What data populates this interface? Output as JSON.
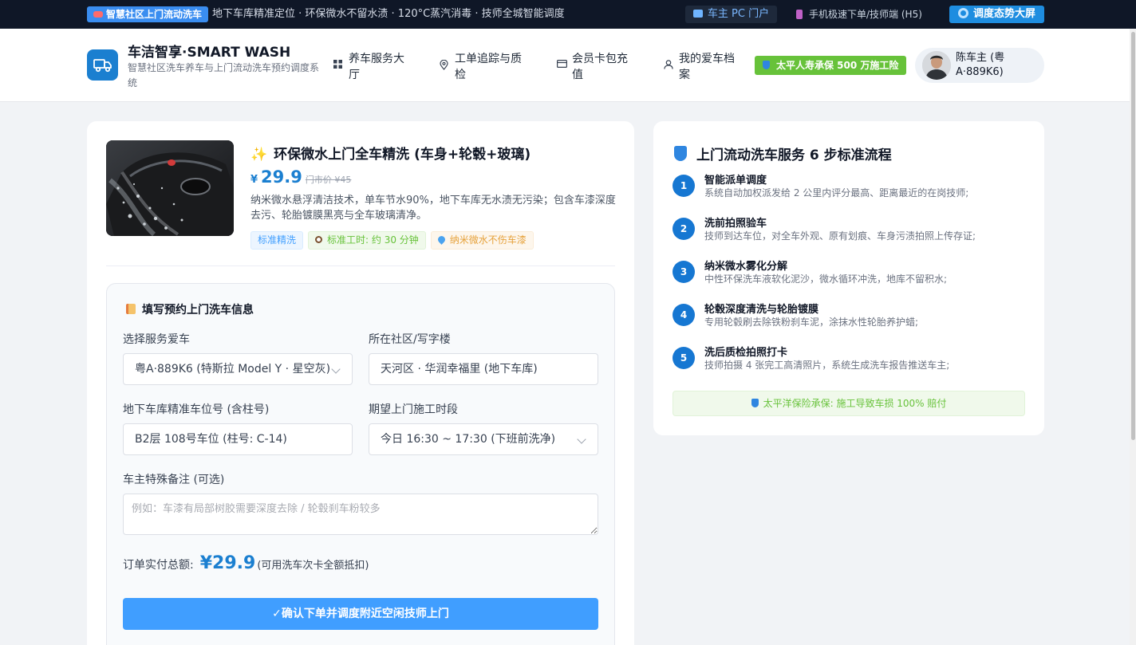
{
  "topbar": {
    "badge": "智慧社区上门流动洗车",
    "ticker": "地下车库精准定位 · 环保微水不留水渍 · 120°C蒸汽消毒 · 技师全城智能调度",
    "portal": "车主 PC 门户",
    "mobile": "手机极速下单/技师端 (H5)",
    "dashboard": "调度态势大屏"
  },
  "header": {
    "brand_title": "车洁智享·SMART WASH",
    "brand_subtitle": "智慧社区洗车养车与上门流动洗车预约调度系统",
    "nav": [
      "养车服务大厅",
      "工单追踪与质检",
      "会员卡包充值",
      "我的爱车档案"
    ],
    "insurance_badge": "太平人寿承保 500 万施工险",
    "user_name": "陈车主 (粤A·889K6)"
  },
  "service": {
    "title": "环保微水上门全车精洗 (车身+轮毂+玻璃)",
    "currency": "¥",
    "price": "29.9",
    "original_price": "门市价 ¥45",
    "description": "纳米微水悬浮清洁技术，单车节水90%，地下车库无水渍无污染；包含车漆深度去污、轮胎镀膜黑亮与全车玻璃清净。",
    "tags": [
      "标准精洗",
      "标准工时: 约 30 分钟",
      "纳米微水不伤车漆"
    ]
  },
  "form": {
    "title": "填写预约上门洗车信息",
    "car_label": "选择服务爱车",
    "car_value": "粤A·889K6 (特斯拉 Model Y · 星空灰)",
    "community_label": "所在社区/写字楼",
    "community_value": "天河区 · 华润幸福里 (地下车库)",
    "parking_label": "地下车库精准车位号 (含柱号)",
    "parking_value": "B2层 108号车位 (柱号: C-14)",
    "time_label": "期望上门施工时段",
    "time_value": "今日 16:30 ~ 17:30 (下班前洗净)",
    "note_label": "车主特殊备注 (可选)",
    "note_placeholder": "例如：车漆有局部树胶需要深度去除 / 轮毂刹车粉较多",
    "total_label": "订单实付总额:",
    "total_value": "¥29.9",
    "total_note": "(可用洗车次卡全额抵扣)",
    "submit": "✓确认下单并调度附近空闲技师上门"
  },
  "flow": {
    "title": "上门流动洗车服务 6 步标准流程",
    "steps": [
      {
        "num": "1",
        "title": "智能派单调度",
        "desc": "系统自动加权派发给 2 公里内评分最高、距离最近的在岗技师;"
      },
      {
        "num": "2",
        "title": "洗前拍照验车",
        "desc": "技师到达车位，对全车外观、原有划痕、车身污渍拍照上传存证;"
      },
      {
        "num": "3",
        "title": "纳米微水雾化分解",
        "desc": "中性环保洗车液软化泥沙，微水循环冲洗，地库不留积水;"
      },
      {
        "num": "4",
        "title": "轮毂深度清洗与轮胎镀膜",
        "desc": "专用轮毂刷去除铁粉刹车泥，涂抹水性轮胎养护蜡;"
      },
      {
        "num": "5",
        "title": "洗后质检拍照打卡",
        "desc": "技师拍摄 4 张完工高清照片，系统生成洗车报告推送车主;"
      }
    ],
    "guarantee": "太平洋保险承保: 施工导致车损 100% 赔付"
  },
  "colors": {
    "primary": "#1b7fd0",
    "button": "#409eff",
    "success": "#67c23a",
    "topbar": "#0f1727"
  }
}
